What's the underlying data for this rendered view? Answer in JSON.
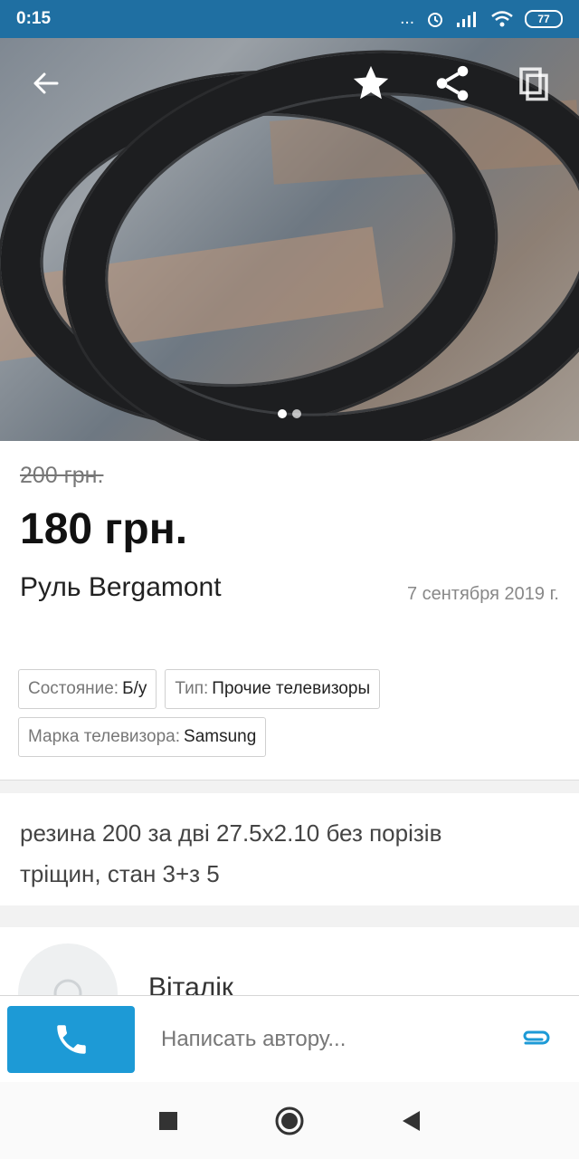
{
  "status_bar": {
    "time": "0:15",
    "signal_dots": "...",
    "battery": "77"
  },
  "gallery": {
    "icons": [
      "back-arrow-icon",
      "star-icon",
      "share-icon",
      "copy-icon"
    ],
    "pager_pages": 2,
    "pager_active": 1
  },
  "listing": {
    "old_price": "200 грн.",
    "price": "180 грн.",
    "title": "Руль Bergamont",
    "date": "7 сентября 2019 г.",
    "tags": [
      {
        "key": "Состояние:",
        "value": "Б/у"
      },
      {
        "key": "Тип:",
        "value": "Прочие телевизоры"
      },
      {
        "key": "Марка телевизора:",
        "value": "Samsung"
      }
    ]
  },
  "description": {
    "line1": "резина 200 за дві 27.5x2.10 без порізів",
    "line2": "тріщин, стан 3+з 5"
  },
  "author": {
    "name": "Віталік"
  },
  "bottom_bar": {
    "message_placeholder": "Написать автору...",
    "accent_color": "#1d9ad6"
  },
  "nav": {
    "buttons": [
      "recents-square-icon",
      "home-circle-icon",
      "back-triangle-icon"
    ]
  }
}
